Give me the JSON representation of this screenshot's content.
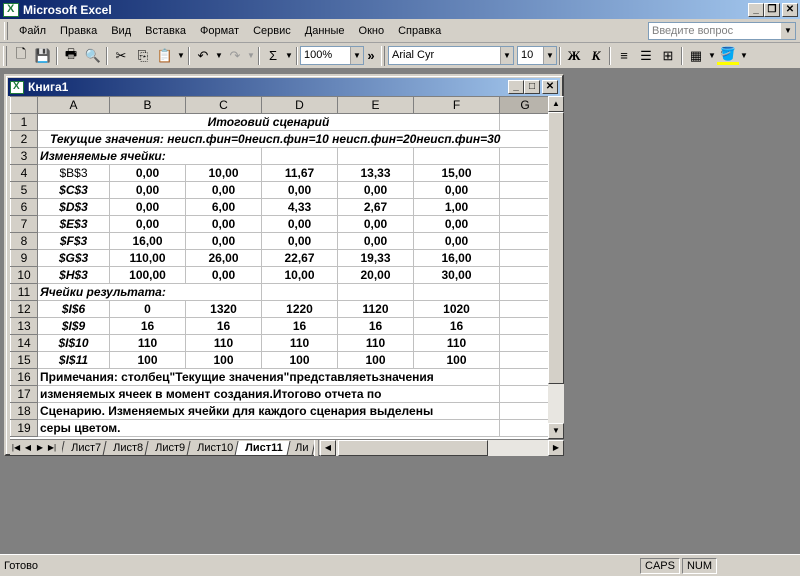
{
  "app": {
    "title": "Microsoft Excel"
  },
  "menu": [
    "Файл",
    "Правка",
    "Вид",
    "Вставка",
    "Формат",
    "Сервис",
    "Данные",
    "Окно",
    "Справка"
  ],
  "help_box": {
    "placeholder": "Введите вопрос"
  },
  "toolbar": {
    "zoom": "100%",
    "font_name": "Arial Cyr",
    "font_size": "10",
    "bold": "Ж",
    "italic": "К",
    "sum": "Σ",
    "more": "»"
  },
  "workbook": {
    "title": "Книга1",
    "columns": [
      "A",
      "B",
      "C",
      "D",
      "E",
      "F",
      "G"
    ],
    "rows": [
      {
        "n": "1",
        "cells": [
          "Итоговий сценарий"
        ]
      },
      {
        "n": "2",
        "cells": [
          "Текущие значения: неисп.фин=0неисп.фин=10 неисп.фин=20неисп.фин=30"
        ]
      },
      {
        "n": "3",
        "cells": [
          "Изменяемые ячейки:"
        ]
      },
      {
        "n": "4",
        "cells": [
          "$B$3",
          "0,00",
          "10,00",
          "11,67",
          "13,33",
          "15,00"
        ]
      },
      {
        "n": "5",
        "cells": [
          "$C$3",
          "0,00",
          "0,00",
          "0,00",
          "0,00",
          "0,00"
        ]
      },
      {
        "n": "6",
        "cells": [
          "$D$3",
          "0,00",
          "6,00",
          "4,33",
          "2,67",
          "1,00"
        ]
      },
      {
        "n": "7",
        "cells": [
          "$E$3",
          "0,00",
          "0,00",
          "0,00",
          "0,00",
          "0,00"
        ]
      },
      {
        "n": "8",
        "cells": [
          "$F$3",
          "16,00",
          "0,00",
          "0,00",
          "0,00",
          "0,00"
        ]
      },
      {
        "n": "9",
        "cells": [
          "$G$3",
          "110,00",
          "26,00",
          "22,67",
          "19,33",
          "16,00"
        ]
      },
      {
        "n": "10",
        "cells": [
          "$H$3",
          "100,00",
          "0,00",
          "10,00",
          "20,00",
          "30,00"
        ]
      },
      {
        "n": "11",
        "cells": [
          "Ячейки результата:"
        ]
      },
      {
        "n": "12",
        "cells": [
          "$I$6",
          "0",
          "1320",
          "1220",
          "1120",
          "1020"
        ]
      },
      {
        "n": "13",
        "cells": [
          "$I$9",
          "16",
          "16",
          "16",
          "16",
          "16"
        ]
      },
      {
        "n": "14",
        "cells": [
          "$I$10",
          "110",
          "110",
          "110",
          "110",
          "110"
        ]
      },
      {
        "n": "15",
        "cells": [
          "$I$11",
          "100",
          "100",
          "100",
          "100",
          "100"
        ]
      },
      {
        "n": "16",
        "cells": [
          "Примечания: столбец\"Текущие значения\"представляетьзначения"
        ]
      },
      {
        "n": "17",
        "cells": [
          "изменяемых ячеек в момент создания.Итогово отчета по"
        ]
      },
      {
        "n": "18",
        "cells": [
          "Сценарию. Изменяемых ячейки для каждого сценария выделены"
        ]
      },
      {
        "n": "19",
        "cells": [
          "серы цветом."
        ]
      }
    ],
    "sheet_tabs": [
      "Лист7",
      "Лист8",
      "Лист9",
      "Лист10",
      "Лист11",
      "Ли"
    ],
    "active_tab": "Лист11"
  },
  "status": {
    "text": "Готово",
    "caps": "CAPS",
    "num": "NUM"
  }
}
